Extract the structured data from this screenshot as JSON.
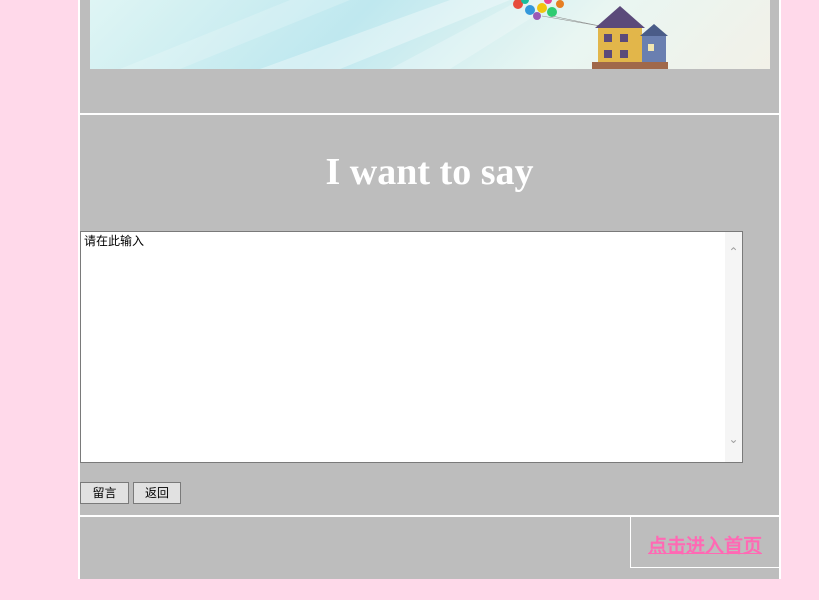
{
  "banner": {
    "image_description_icon": "house-with-balloons-image"
  },
  "message": {
    "title": "I want to say",
    "textarea_value": "请在此输入",
    "post_button": "留言",
    "back_button": "返回"
  },
  "footer": {
    "home_link": "点击进入首页"
  },
  "colors": {
    "page_background": "#ffd9ea",
    "panel_background": "#bdbdbd",
    "title_color": "#ffffff",
    "link_color": "#ff69b4"
  }
}
